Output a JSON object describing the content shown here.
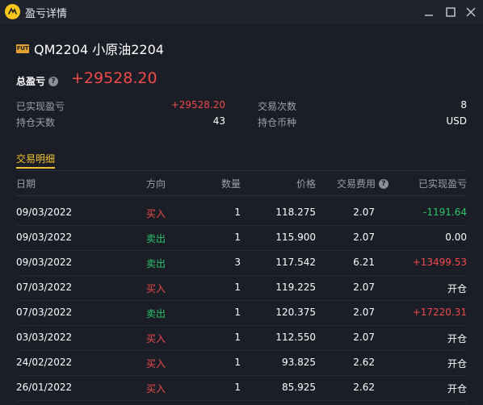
{
  "window": {
    "title": "盈亏详情",
    "controls": [
      "minimize-icon",
      "maximize-icon",
      "close-icon"
    ]
  },
  "instrument": {
    "badge": "FUT",
    "title": "QM2204 小原油2204"
  },
  "pnl": {
    "label": "总盈亏",
    "value": "+29528.20"
  },
  "summary": {
    "realized_label": "已实现盈亏",
    "realized_value": "+29528.20",
    "trades_label": "交易次数",
    "trades_value": "8",
    "days_label": "持仓天数",
    "days_value": "43",
    "currency_label": "持仓币种",
    "currency_value": "USD"
  },
  "tab": {
    "label": "交易明细"
  },
  "table": {
    "headers": {
      "date": "日期",
      "direction": "方向",
      "qty": "数量",
      "price": "价格",
      "fee": "交易费用",
      "realized": "已实现盈亏"
    },
    "rows": [
      {
        "date": "09/03/2022",
        "direction": "买入",
        "qty": "1",
        "price": "118.275",
        "fee": "2.07",
        "realized": "-1191.64"
      },
      {
        "date": "09/03/2022",
        "direction": "卖出",
        "qty": "1",
        "price": "115.900",
        "fee": "2.07",
        "realized": "0.00"
      },
      {
        "date": "09/03/2022",
        "direction": "卖出",
        "qty": "3",
        "price": "117.542",
        "fee": "6.21",
        "realized": "+13499.53"
      },
      {
        "date": "07/03/2022",
        "direction": "买入",
        "qty": "1",
        "price": "119.225",
        "fee": "2.07",
        "realized": "开仓"
      },
      {
        "date": "07/03/2022",
        "direction": "卖出",
        "qty": "1",
        "price": "120.375",
        "fee": "2.07",
        "realized": "+17220.31"
      },
      {
        "date": "03/03/2022",
        "direction": "买入",
        "qty": "1",
        "price": "112.550",
        "fee": "2.07",
        "realized": "开仓"
      },
      {
        "date": "24/02/2022",
        "direction": "买入",
        "qty": "1",
        "price": "93.825",
        "fee": "2.62",
        "realized": "开仓"
      },
      {
        "date": "26/01/2022",
        "direction": "买入",
        "qty": "1",
        "price": "85.925",
        "fee": "2.62",
        "realized": "开仓"
      }
    ]
  },
  "colors": {
    "background": "#1b1e26",
    "profit_red": "#f04a4a",
    "loss_green": "#2ec56a",
    "accent_yellow": "#f2c230"
  }
}
